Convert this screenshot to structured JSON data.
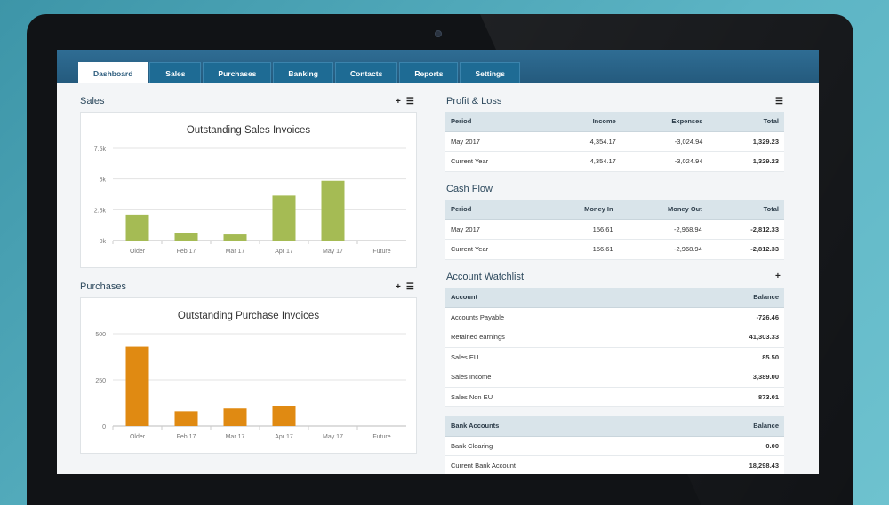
{
  "nav": {
    "tabs": [
      {
        "label": "Dashboard",
        "active": true
      },
      {
        "label": "Sales"
      },
      {
        "label": "Purchases"
      },
      {
        "label": "Banking"
      },
      {
        "label": "Contacts"
      },
      {
        "label": "Reports"
      },
      {
        "label": "Settings"
      }
    ]
  },
  "sales": {
    "title": "Sales",
    "icons": [
      "plus-icon",
      "list-icon"
    ],
    "chart_title": "Outstanding Sales Invoices"
  },
  "purchases": {
    "title": "Purchases",
    "icons": [
      "plus-icon",
      "list-icon"
    ],
    "chart_title": "Outstanding Purchase Invoices"
  },
  "chart_data": [
    {
      "type": "bar",
      "title": "Outstanding Sales Invoices",
      "categories": [
        "Older",
        "Feb 17",
        "Mar 17",
        "Apr 17",
        "May 17",
        "Future"
      ],
      "values": [
        2100,
        600,
        500,
        3650,
        4850,
        0
      ],
      "yticks": [
        "0k",
        "2.5k",
        "5k",
        "7.5k"
      ],
      "ylim": [
        0,
        7500
      ],
      "color": "#a5bb54",
      "grid": true
    },
    {
      "type": "bar",
      "title": "Outstanding Purchase Invoices",
      "categories": [
        "Older",
        "Feb 17",
        "Mar 17",
        "Apr 17",
        "May 17",
        "Future"
      ],
      "values": [
        430,
        80,
        95,
        110,
        0,
        0
      ],
      "yticks": [
        "0",
        "250",
        "500"
      ],
      "ylim": [
        0,
        500
      ],
      "color": "#e08a12",
      "grid": true
    }
  ],
  "profit_loss": {
    "title": "Profit & Loss",
    "headers": [
      "Period",
      "Income",
      "Expenses",
      "Total"
    ],
    "rows": [
      [
        "May 2017",
        "4,354.17",
        "-3,024.94",
        "1,329.23"
      ],
      [
        "Current Year",
        "4,354.17",
        "-3,024.94",
        "1,329.23"
      ]
    ]
  },
  "cash_flow": {
    "title": "Cash Flow",
    "headers": [
      "Period",
      "Money In",
      "Money Out",
      "Total"
    ],
    "rows": [
      [
        "May 2017",
        "156.61",
        "-2,968.94",
        "-2,812.33"
      ],
      [
        "Current Year",
        "156.61",
        "-2,968.94",
        "-2,812.33"
      ]
    ]
  },
  "watchlist": {
    "title": "Account Watchlist",
    "headers": [
      "Account",
      "Balance"
    ],
    "rows": [
      [
        "Accounts Payable",
        "-726.46"
      ],
      [
        "Retained earnings",
        "41,303.33"
      ],
      [
        "Sales EU",
        "85.50"
      ],
      [
        "Sales Income",
        "3,389.00"
      ],
      [
        "Sales Non EU",
        "873.01"
      ]
    ]
  },
  "bank_accounts": {
    "headers": [
      "Bank Accounts",
      "Balance"
    ],
    "rows": [
      [
        "Bank Clearing",
        "0.00"
      ],
      [
        "Current Bank Account",
        "18,298.43"
      ]
    ]
  },
  "colors": {
    "nav_bar": "#245a7d",
    "positive": "#5b7a16",
    "negative": "#b7202f",
    "link": "#2f6fa6",
    "sales_bar": "#a5bb54",
    "purchase_bar": "#e08a12"
  }
}
